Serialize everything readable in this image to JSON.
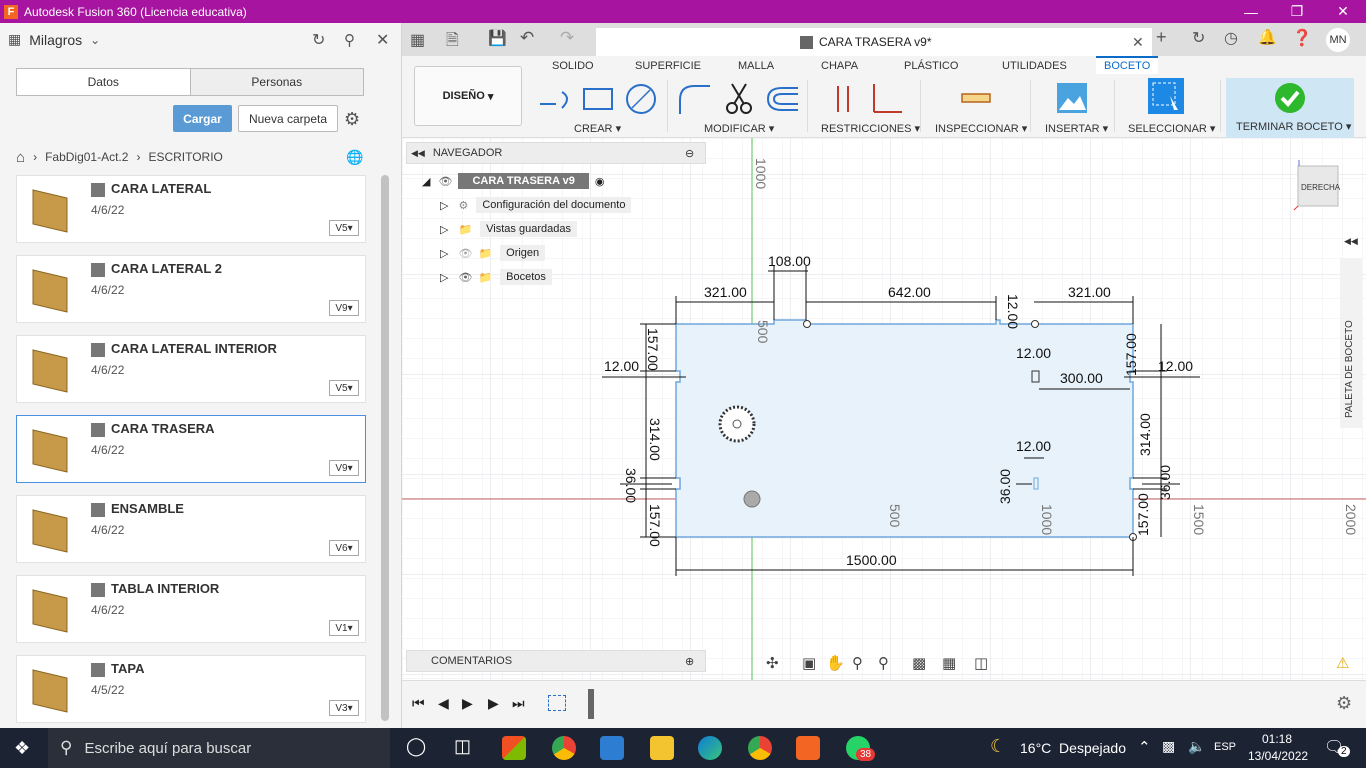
{
  "titlebar": {
    "title": "Autodesk Fusion 360 (Licencia educativa)",
    "logo_letter": "F"
  },
  "left": {
    "project": "Milagros",
    "tabs": [
      "Datos",
      "Personas"
    ],
    "upload_label": "Cargar",
    "newfolder_label": "Nueva carpeta",
    "breadcrumb": [
      "FabDig01-Act.2",
      "ESCRITORIO"
    ],
    "files": [
      {
        "name": "CARA LATERAL",
        "date": "4/6/22",
        "version": "V5"
      },
      {
        "name": "CARA LATERAL 2",
        "date": "4/6/22",
        "version": "V9"
      },
      {
        "name": "CARA LATERAL INTERIOR",
        "date": "4/6/22",
        "version": "V5"
      },
      {
        "name": "CARA TRASERA",
        "date": "4/6/22",
        "version": "V9"
      },
      {
        "name": "ENSAMBLE",
        "date": "4/6/22",
        "version": "V6"
      },
      {
        "name": "TABLA INTERIOR",
        "date": "4/6/22",
        "version": "V1"
      },
      {
        "name": "TAPA",
        "date": "4/5/22",
        "version": "V3"
      }
    ]
  },
  "doc_tab": {
    "title": "CARA TRASERA v9*"
  },
  "user_initials": "MN",
  "ribbon": {
    "workspace": "DISEÑO",
    "tabs": [
      "SOLIDO",
      "SUPERFICIE",
      "MALLA",
      "CHAPA",
      "PLÁSTICO",
      "UTILIDADES",
      "BOCETO"
    ],
    "groups": [
      "CREAR",
      "MODIFICAR",
      "RESTRICCIONES",
      "INSPECCIONAR",
      "INSERTAR",
      "SELECCIONAR",
      "TERMINAR BOCETO"
    ]
  },
  "navigator": {
    "title": "NAVEGADOR",
    "root": "CARA TRASERA v9",
    "items": [
      "Configuración del documento",
      "Vistas guardadas",
      "Origen",
      "Bocetos"
    ]
  },
  "comments_label": "COMENTARIOS",
  "palette_label": "PALETA DE BOCETO",
  "viewcube_label": "DERECHA",
  "dimensions": {
    "top_left": "321.00",
    "notch": "108.00",
    "top_mid": "642.00",
    "top_right": "321.00",
    "top_small": "12.00",
    "left_tab": "12.00",
    "right_tab": "12.00",
    "total": "1500.00",
    "v157a": "157.00",
    "v314a": "314.00",
    "v36a": "36.00",
    "v157b": "157.00",
    "r157a": "157.00",
    "r314": "314.00",
    "r36": "36.00",
    "r157b": "157.00",
    "inner12a": "12.00",
    "inner300": "300.00",
    "inner12b": "12.00",
    "inner36": "36.00"
  },
  "axis_labels": {
    "y1000": "1000",
    "y500": "500",
    "x500": "500",
    "x1000": "1000",
    "x1500": "1500",
    "x2000": "2000"
  },
  "taskbar": {
    "search_placeholder": "Escribe aquí para buscar",
    "weather": "16°C  Despejado",
    "lang": "ESP",
    "time": "01:18",
    "date": "13/04/2022",
    "whatsapp_badge": "38",
    "notif_badge": "2"
  }
}
